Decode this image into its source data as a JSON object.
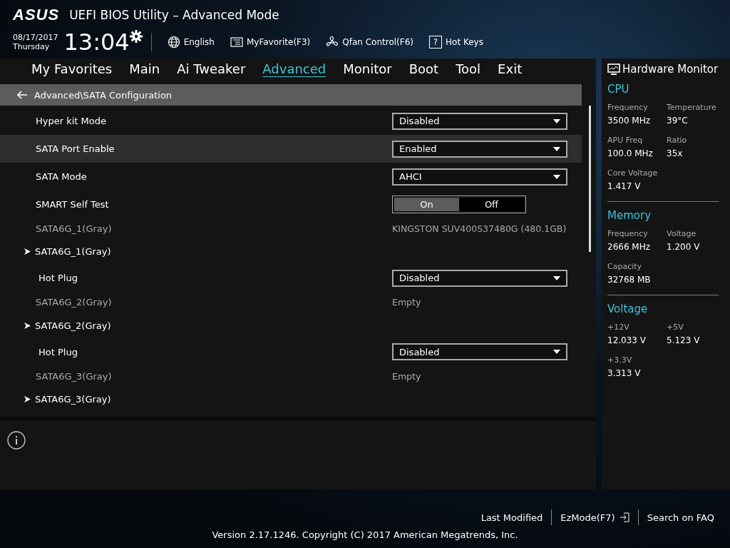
{
  "header": {
    "brand": "ASUS",
    "title": "UEFI BIOS Utility – Advanced Mode",
    "date": "08/17/2017",
    "weekday": "Thursday",
    "time": "13:04",
    "tools": [
      {
        "kind": "language",
        "label": "English"
      },
      {
        "kind": "favorite",
        "label": "MyFavorite(F3)"
      },
      {
        "kind": "fan",
        "label": "Qfan Control(F6)"
      },
      {
        "kind": "help",
        "icon": "?",
        "label": "Hot Keys"
      }
    ]
  },
  "tabs": [
    {
      "label": "My Favorites",
      "selected": false
    },
    {
      "label": "Main",
      "selected": false
    },
    {
      "label": "Ai Tweaker",
      "selected": false
    },
    {
      "label": "Advanced",
      "selected": true
    },
    {
      "label": "Monitor",
      "selected": false
    },
    {
      "label": "Boot",
      "selected": false
    },
    {
      "label": "Tool",
      "selected": false
    },
    {
      "label": "Exit",
      "selected": false
    }
  ],
  "breadcrumb": "Advanced\\SATA Configuration",
  "settings": [
    {
      "kind": "dropdown",
      "label": "Hyper kit Mode",
      "value": "Disabled",
      "selected": false
    },
    {
      "kind": "dropdown",
      "label": "SATA Port Enable",
      "value": "Enabled",
      "selected": true
    },
    {
      "kind": "dropdown",
      "label": "SATA Mode",
      "value": "AHCI",
      "selected": false
    },
    {
      "kind": "toggle",
      "label": "SMART Self Test",
      "options": [
        {
          "label": "On",
          "selected": true
        },
        {
          "label": "Off",
          "selected": false
        }
      ],
      "selected": false
    },
    {
      "kind": "info",
      "label": "SATA6G_1(Gray)",
      "value": "KINGSTON SUV400S37480G (480.1GB)",
      "selected": false
    },
    {
      "kind": "submenu",
      "label": "SATA6G_1(Gray)",
      "selected": false
    },
    {
      "kind": "subdropdown",
      "label": "Hot Plug",
      "value": "Disabled",
      "selected": false
    },
    {
      "kind": "info",
      "label": "SATA6G_2(Gray)",
      "value": "Empty",
      "selected": false
    },
    {
      "kind": "submenu",
      "label": "SATA6G_2(Gray)",
      "selected": false
    },
    {
      "kind": "subdropdown",
      "label": "Hot Plug",
      "value": "Disabled",
      "selected": false
    },
    {
      "kind": "info",
      "label": "SATA6G_3(Gray)",
      "value": "Empty",
      "selected": false
    },
    {
      "kind": "submenu",
      "label": "SATA6G_3(Gray)",
      "selected": false
    }
  ],
  "hardware_monitor": {
    "title": "Hardware Monitor",
    "sections": [
      {
        "title": "CPU",
        "items": [
          {
            "label": "Frequency",
            "value": "3500 MHz"
          },
          {
            "label": "Temperature",
            "value": "39°C"
          },
          {
            "label": "APU Freq",
            "value": "100.0 MHz"
          },
          {
            "label": "Ratio",
            "value": "35x"
          },
          {
            "label": "Core Voltage",
            "value": "1.417 V"
          }
        ]
      },
      {
        "title": "Memory",
        "items": [
          {
            "label": "Frequency",
            "value": "2666 MHz"
          },
          {
            "label": "Voltage",
            "value": "1.200 V"
          },
          {
            "label": "Capacity",
            "value": "32768 MB"
          }
        ]
      },
      {
        "title": "Voltage",
        "items": [
          {
            "label": "+12V",
            "value": "12.033 V"
          },
          {
            "label": "+5V",
            "value": "5.123 V"
          },
          {
            "label": "+3.3V",
            "value": "3.313 V"
          }
        ]
      }
    ]
  },
  "footer": {
    "links": [
      "Last Modified",
      "EzMode(F7)",
      "Search on FAQ"
    ],
    "version": "Version 2.17.1246. Copyright (C) 2017 American Megatrends, Inc."
  }
}
